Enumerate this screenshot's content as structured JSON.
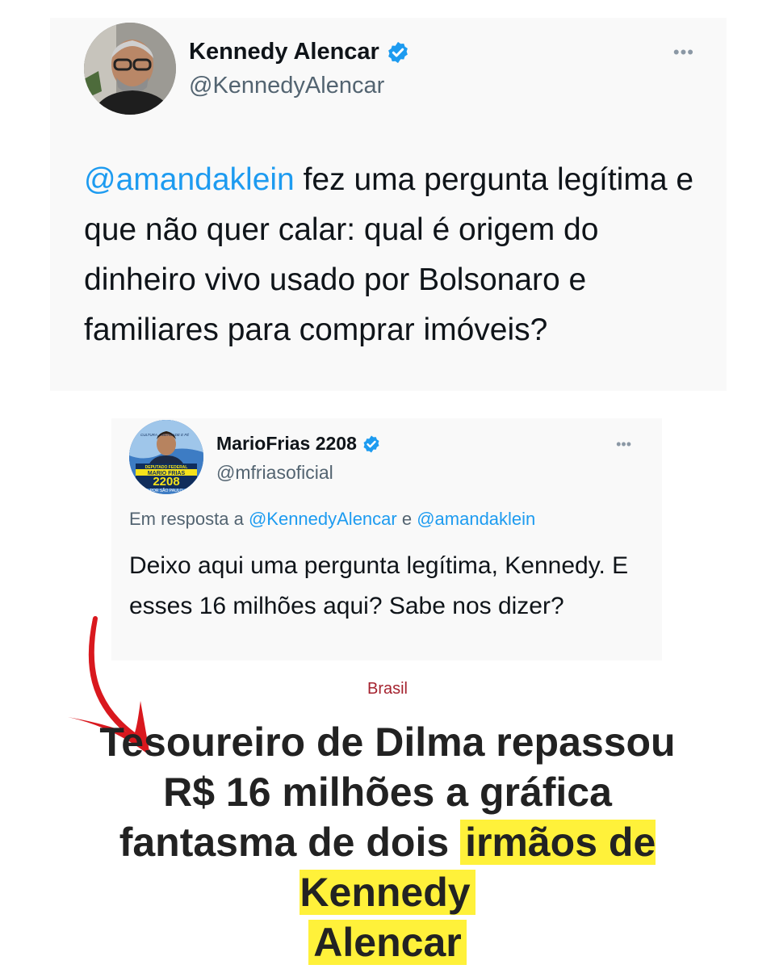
{
  "tweet_main": {
    "author_name": "Kennedy Alencar",
    "author_handle": "@KennedyAlencar",
    "more_label": "•••",
    "text_mention": "@amandaklein",
    "text_body": " fez uma pergunta legítima e que não quer calar: qual é origem do dinheiro vivo usado por Bolsonaro e familiares para comprar imóveis?"
  },
  "tweet_reply": {
    "author_name": "MarioFrias 2208",
    "author_handle": "@mfriasoficial",
    "more_label": "•••",
    "reply_prefix": "Em resposta a ",
    "reply_to_1": "@KennedyAlencar",
    "reply_joiner": " e ",
    "reply_to_2": "@amandaklein",
    "text": "Deixo aqui uma pergunta legítima, Kennedy. E esses 16 milhões aqui? Sabe nos dizer?",
    "avatar_text": {
      "line1": "DEPUTADO FEDERAL",
      "line2": "MARIO FRIAS",
      "line3": "2208",
      "line4": "POR SÃO PAULO",
      "slogan": "CULTURA, LIBERDADE E FÉ"
    }
  },
  "article": {
    "category": "Brasil",
    "headline_part1": "Tesoureiro de Dilma repassou R$ 16 milhões a gráfica fantasma de dois ",
    "headline_highlight_1": "irmãos de Kennedy",
    "headline_highlight_2": "Alencar"
  },
  "colors": {
    "link": "#1d9bf0",
    "verified": "#1d9bf0",
    "category": "#a5232f",
    "highlight": "#fff13a",
    "arrow": "#d9181e"
  }
}
